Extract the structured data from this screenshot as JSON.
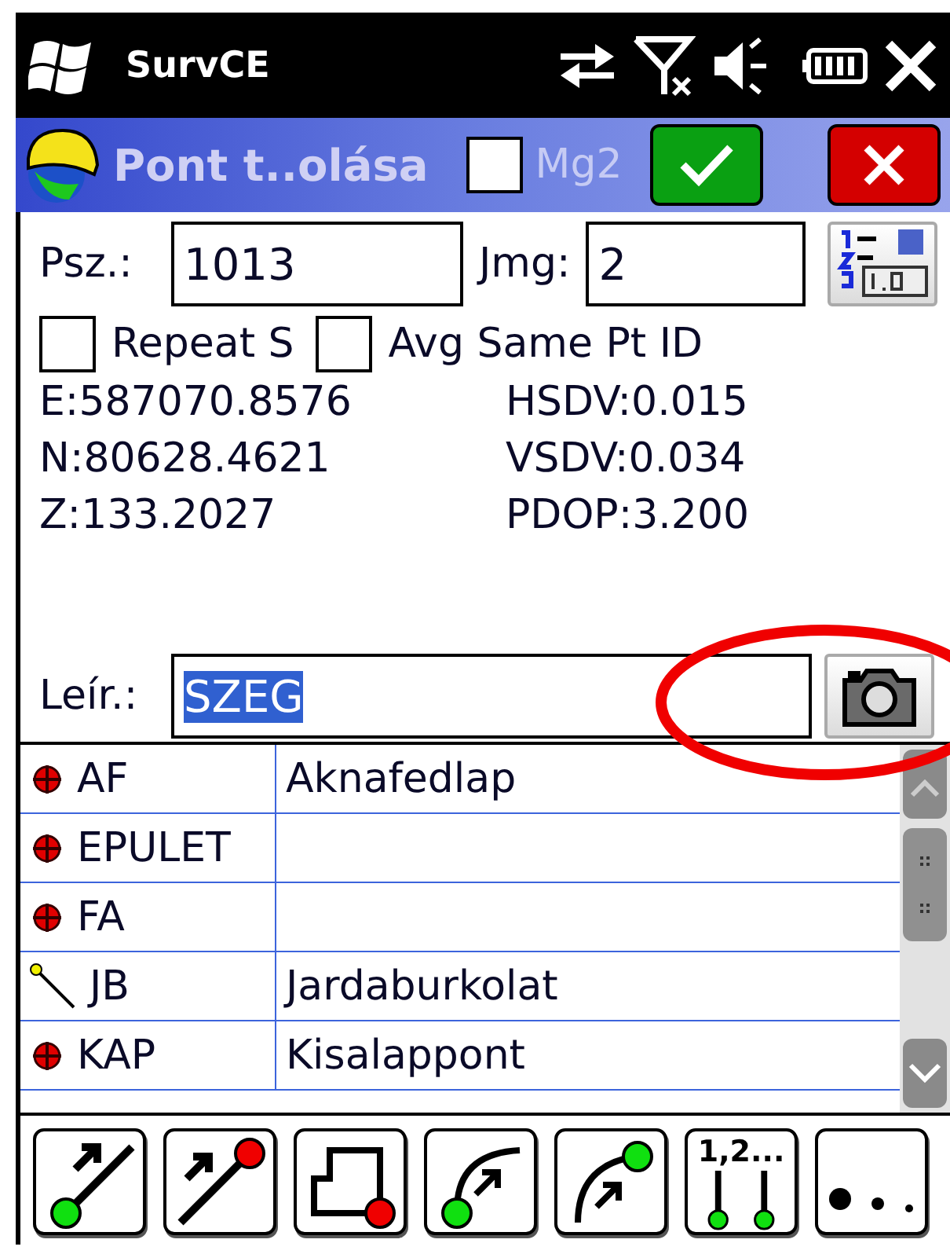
{
  "status_bar": {
    "app": "SurvCE"
  },
  "title_bar": {
    "title": "Pont t..olása",
    "mg2": {
      "label": "Mg2",
      "checked": false
    }
  },
  "form": {
    "point": {
      "label": "Psz.:",
      "value": "1013"
    },
    "height": {
      "label": "Jmg:",
      "value": "2"
    },
    "options": [
      {
        "label": "Repeat S",
        "checked": false
      },
      {
        "label": "Avg Same Pt ID",
        "checked": false
      }
    ],
    "readings_left": [
      "E:587070.8576",
      "N:80628.4621",
      "Z:133.2027"
    ],
    "readings_right": [
      "HSDV:0.015",
      "VSDV:0.034",
      "PDOP:3.200"
    ],
    "description": {
      "label": "Leír.:",
      "value": "SZEG",
      "selected": true
    }
  },
  "codes": [
    {
      "code": "AF",
      "description": "Aknafedlap",
      "kind": "point"
    },
    {
      "code": "EPULET",
      "kind": "point"
    },
    {
      "code": "FA",
      "kind": "point"
    },
    {
      "code": "JB",
      "description": "Jardaburkolat",
      "kind": "line"
    },
    {
      "code": "KAP",
      "description": "Kisalappont",
      "kind": "point"
    }
  ],
  "toolbar": [
    {
      "kind": "line-start"
    },
    {
      "kind": "line-end"
    },
    {
      "kind": "offset"
    },
    {
      "kind": "arc-start"
    },
    {
      "kind": "arc-end"
    },
    {
      "kind": "numbering",
      "label": "1,2..."
    },
    {
      "kind": "more"
    }
  ]
}
